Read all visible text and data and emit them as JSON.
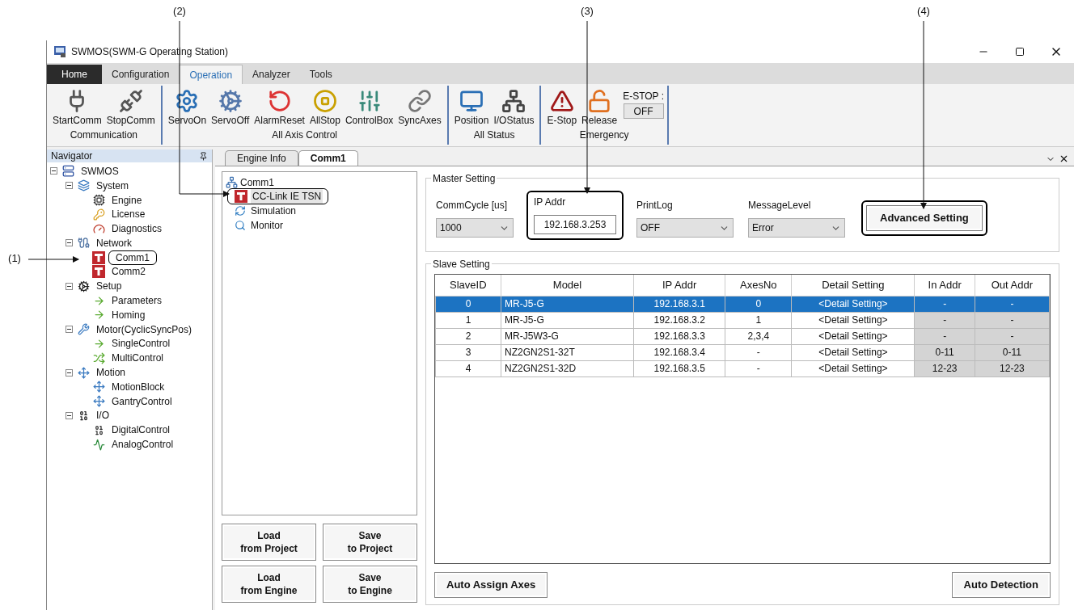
{
  "callouts": [
    {
      "label": "(1)"
    },
    {
      "label": "(2)"
    },
    {
      "label": "(3)"
    },
    {
      "label": "(4)"
    }
  ],
  "window": {
    "title": "SWMOS(SWM-G Operating Station)"
  },
  "ribbon_tabs": [
    {
      "label": "Home",
      "kind": "home",
      "selected": false
    },
    {
      "label": "Configuration",
      "kind": "tab",
      "selected": false
    },
    {
      "label": "Operation",
      "kind": "tab",
      "selected": true
    },
    {
      "label": "Analyzer",
      "kind": "tab",
      "selected": false
    },
    {
      "label": "Tools",
      "kind": "tab",
      "selected": false
    }
  ],
  "ribbon_groups": [
    {
      "label": "Communication",
      "items": [
        {
          "label": "StartComm"
        },
        {
          "label": "StopComm"
        }
      ]
    },
    {
      "label": "All Axis Control",
      "items": [
        {
          "label": "ServoOn"
        },
        {
          "label": "ServoOff"
        },
        {
          "label": "AlarmReset"
        },
        {
          "label": "AllStop"
        },
        {
          "label": "ControlBox"
        },
        {
          "label": "SyncAxes"
        }
      ]
    },
    {
      "label": "All Status",
      "items": [
        {
          "label": "Position"
        },
        {
          "label": "I/OStatus"
        }
      ]
    },
    {
      "label": "Emergency",
      "items": [
        {
          "label": "E-Stop"
        },
        {
          "label": "Release"
        }
      ],
      "estop": {
        "label": "E-STOP :",
        "value": "OFF"
      }
    }
  ],
  "navigator": {
    "title": "Navigator",
    "tree": [
      {
        "label": "SWMOS",
        "expanded": true,
        "highlighted": false,
        "children": [
          {
            "label": "System",
            "expanded": true,
            "highlighted": false,
            "children": [
              {
                "label": "Engine",
                "highlighted": false
              },
              {
                "label": "License",
                "highlighted": false
              },
              {
                "label": "Diagnostics",
                "highlighted": false
              }
            ]
          },
          {
            "label": "Network",
            "expanded": true,
            "highlighted": false,
            "children": [
              {
                "label": "Comm1",
                "highlighted": true
              },
              {
                "label": "Comm2",
                "highlighted": false
              }
            ]
          },
          {
            "label": "Setup",
            "expanded": true,
            "highlighted": false,
            "children": [
              {
                "label": "Parameters",
                "highlighted": false
              },
              {
                "label": "Homing",
                "highlighted": false
              }
            ]
          },
          {
            "label": "Motor(CyclicSyncPos)",
            "expanded": true,
            "highlighted": false,
            "children": [
              {
                "label": "SingleControl",
                "highlighted": false
              },
              {
                "label": "MultiControl",
                "highlighted": false
              }
            ]
          },
          {
            "label": "Motion",
            "expanded": true,
            "highlighted": false,
            "children": [
              {
                "label": "MotionBlock",
                "highlighted": false
              },
              {
                "label": "GantryControl",
                "highlighted": false
              }
            ]
          },
          {
            "label": "I/O",
            "expanded": true,
            "highlighted": false,
            "children": [
              {
                "label": "DigitalControl",
                "highlighted": false
              },
              {
                "label": "AnalogControl",
                "highlighted": false
              }
            ]
          }
        ]
      }
    ]
  },
  "doc_tabs": [
    {
      "label": "Engine Info",
      "selected": false
    },
    {
      "label": "Comm1",
      "selected": true
    }
  ],
  "comm_tree": {
    "label": "Comm1",
    "children": [
      {
        "label": "CC-Link IE TSN",
        "highlighted": true,
        "selected": true
      },
      {
        "label": "Simulation",
        "highlighted": false,
        "selected": false
      },
      {
        "label": "Monitor",
        "highlighted": false,
        "selected": false
      }
    ]
  },
  "side_buttons": [
    {
      "lines": [
        "Load",
        "from Project"
      ]
    },
    {
      "lines": [
        "Save",
        "to Project"
      ]
    },
    {
      "lines": [
        "Load",
        "from Engine"
      ]
    },
    {
      "lines": [
        "Save",
        "to Engine"
      ]
    }
  ],
  "master_setting": {
    "title": "Master Setting",
    "fields": [
      {
        "kind": "select",
        "label": "CommCycle [us]",
        "value": "1000",
        "highlighted": false
      },
      {
        "kind": "input",
        "label": "IP Addr",
        "value": "192.168.3.253",
        "highlighted": true
      },
      {
        "kind": "select",
        "label": "PrintLog",
        "value": "OFF",
        "highlighted": false
      },
      {
        "kind": "select",
        "label": "MessageLevel",
        "value": "Error",
        "highlighted": false
      }
    ],
    "button": {
      "label": "Advanced Setting",
      "highlighted": true
    }
  },
  "slave_setting": {
    "title": "Slave Setting",
    "columns": [
      {
        "label": "SlaveID",
        "readonly": false
      },
      {
        "label": "Model",
        "readonly": false
      },
      {
        "label": "IP Addr",
        "readonly": false
      },
      {
        "label": "AxesNo",
        "readonly": false
      },
      {
        "label": "Detail Setting",
        "readonly": false
      },
      {
        "label": "In Addr",
        "readonly": true
      },
      {
        "label": "Out Addr",
        "readonly": true
      }
    ],
    "rows": [
      {
        "selected": true,
        "cells": [
          "0",
          "MR-J5-G",
          "192.168.3.1",
          "0",
          "<Detail Setting>",
          "-",
          "-"
        ]
      },
      {
        "selected": false,
        "cells": [
          "1",
          "MR-J5-G",
          "192.168.3.2",
          "1",
          "<Detail Setting>",
          "-",
          "-"
        ]
      },
      {
        "selected": false,
        "cells": [
          "2",
          "MR-J5W3-G",
          "192.168.3.3",
          "2,3,4",
          "<Detail Setting>",
          "-",
          "-"
        ]
      },
      {
        "selected": false,
        "cells": [
          "3",
          "NZ2GN2S1-32T",
          "192.168.3.4",
          "-",
          "<Detail Setting>",
          "0-11",
          "0-11"
        ]
      },
      {
        "selected": false,
        "cells": [
          "4",
          "NZ2GN2S1-32D",
          "192.168.3.5",
          "-",
          "<Detail Setting>",
          "12-23",
          "12-23"
        ]
      }
    ],
    "buttons": [
      {
        "label": "Auto Assign Axes"
      },
      {
        "label": "Auto Detection"
      }
    ]
  }
}
